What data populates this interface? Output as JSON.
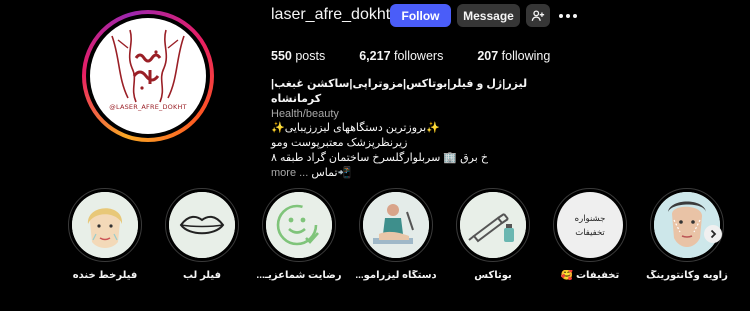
{
  "profile": {
    "avatar_caption": "@LASER_AFRE_DOKHT",
    "username": "laser_afre_dokht",
    "follow_label": "Follow",
    "message_label": "Message",
    "stats": {
      "posts": "550",
      "posts_label": "posts",
      "followers": "6,217",
      "followers_label": "followers",
      "following": "207",
      "following_label": "following"
    },
    "bio": {
      "name": "لیزر|ژل و فیلر|بوتاکس|مزوتراپی|ساکشن غبغب|کرمانشاه",
      "category": "Health/beauty",
      "line1": "✨بروزترین دستگاههای لیزرزیبایی✨",
      "line2": "زیرنظرپزشک معتبرپوست ومو",
      "line3": "خ برق 🏢 سربلوارگلسرخ ساختمان گراد طبقه ۸",
      "line4": "📲تماس",
      "more_text": "... more"
    }
  },
  "highlights": [
    {
      "label": "فیلرخط خنده",
      "icon": "woman-face-icon"
    },
    {
      "label": "فیلر لب",
      "icon": "lips-icon"
    },
    {
      "label": "رضایت شماعزیـ...",
      "icon": "smiley-check-icon"
    },
    {
      "label": "دستگاه لیزرامو...",
      "icon": "laser-treatment-icon"
    },
    {
      "label": "بوتاکس",
      "icon": "syringe-icon"
    },
    {
      "label": "تخفیفات 🥰",
      "icon": "discount-text-icon",
      "inner_line1": "جشنواره",
      "inner_line2": "تخفیفات"
    },
    {
      "label": "زاویه وکانتورینگ",
      "icon": "contouring-face-icon"
    }
  ],
  "colors": {
    "background": "#000000",
    "follow_button": "#4a5df9",
    "secondary_button": "#363636",
    "text_primary": "#f5f5f5",
    "text_secondary": "#a8a8a8",
    "logo_red": "#9a1f26"
  }
}
